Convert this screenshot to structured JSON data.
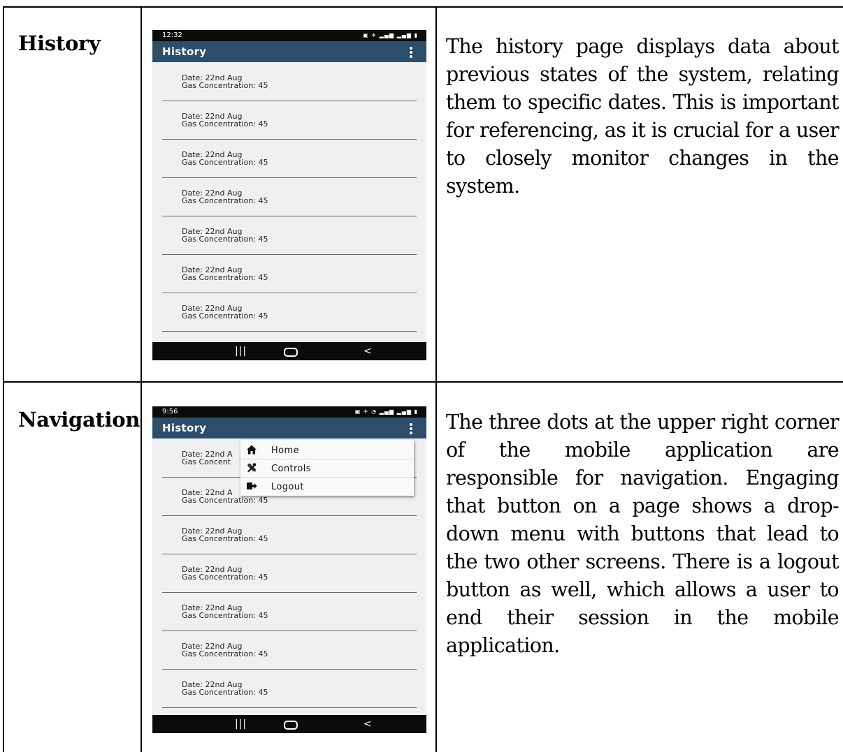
{
  "rows": [
    {
      "label": "History",
      "description": "The history page displays data about previous states of the system, relating them to specific dates. This is important for referencing, as it is crucial for a user to closely monitor changes in the system."
    },
    {
      "label": "Navigation",
      "description": "The three dots at the upper right corner of the mobile application are responsible for navigation. Engaging that button on a page shows a drop-down menu with buttons that lead to the two other screens. There is a logout button as well, which allows a user to end their session in the mobile application."
    }
  ],
  "phone1": {
    "time": "12:32",
    "title": "History",
    "items": [
      {
        "date": "Date: 22nd Aug",
        "gas": "Gas Concentration: 45"
      },
      {
        "date": "Date: 22nd Aug",
        "gas": "Gas Concentration: 45"
      },
      {
        "date": "Date: 22nd Aug",
        "gas": "Gas Concentration: 45"
      },
      {
        "date": "Date: 22nd Aug",
        "gas": "Gas Concentration: 45"
      },
      {
        "date": "Date: 22nd Aug",
        "gas": "Gas Concentration: 45"
      },
      {
        "date": "Date: 22nd Aug",
        "gas": "Gas Concentration: 45"
      },
      {
        "date": "Date: 22nd Aug",
        "gas": "Gas Concentration: 45"
      }
    ]
  },
  "phone2": {
    "time": "9:56",
    "title": "History",
    "items": [
      {
        "date": "Date: 22nd A",
        "gas": "Gas Concent"
      },
      {
        "date": "Date: 22nd A",
        "gas": "Gas Concentration: 45"
      },
      {
        "date": "Date: 22nd Aug",
        "gas": "Gas Concentration: 45"
      },
      {
        "date": "Date: 22nd Aug",
        "gas": "Gas Concentration: 45"
      },
      {
        "date": "Date: 22nd Aug",
        "gas": "Gas Concentration: 45"
      },
      {
        "date": "Date: 22nd Aug",
        "gas": "Gas Concentration: 45"
      },
      {
        "date": "Date: 22nd Aug",
        "gas": "Gas Concentration: 45"
      }
    ],
    "menu": [
      {
        "label": "Home",
        "icon": "home-icon"
      },
      {
        "label": "Controls",
        "icon": "tools-icon"
      },
      {
        "label": "Logout",
        "icon": "logout-icon"
      }
    ]
  },
  "colors": {
    "app_bar": "#2d4e6b",
    "status_bar": "#0b0b0b",
    "list_bg": "#f0f0f0"
  }
}
